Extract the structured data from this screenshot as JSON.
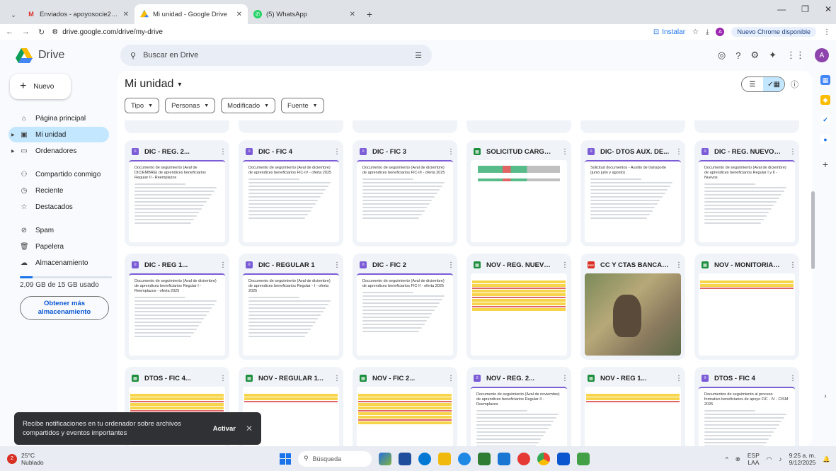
{
  "browser": {
    "tabs": [
      {
        "title": "Enviados - apoyosocie2025@",
        "icon": "gmail-icon",
        "active": false
      },
      {
        "title": "Mi unidad - Google Drive",
        "icon": "drive-icon",
        "active": true
      },
      {
        "title": "(5) WhatsApp",
        "icon": "whatsapp-icon",
        "active": false
      }
    ],
    "url": "drive.google.com/drive/my-drive",
    "install_label": "Instalar",
    "profile_initial": "A",
    "update_label": "Nuevo Chrome disponible"
  },
  "drive": {
    "logo_text": "Drive",
    "search_placeholder": "Buscar en Drive",
    "avatar_initial": "A"
  },
  "sidebar": {
    "new_label": "Nuevo",
    "items": [
      {
        "label": "Página principal",
        "icon": "home-icon"
      },
      {
        "label": "Mi unidad",
        "icon": "drive-folder-icon"
      },
      {
        "label": "Ordenadores",
        "icon": "computer-icon"
      },
      {
        "label": "Compartido conmigo",
        "icon": "shared-icon"
      },
      {
        "label": "Reciente",
        "icon": "clock-icon"
      },
      {
        "label": "Destacados",
        "icon": "star-icon"
      },
      {
        "label": "Spam",
        "icon": "spam-icon"
      },
      {
        "label": "Papelera",
        "icon": "trash-icon"
      },
      {
        "label": "Almacenamiento",
        "icon": "cloud-icon"
      }
    ],
    "storage_text": "2,09 GB de 15 GB usado",
    "storage_fraction": 0.14,
    "more_storage": "Obtener más almacenamiento"
  },
  "main": {
    "title": "Mi unidad",
    "filters": [
      "Tipo",
      "Personas",
      "Modificado",
      "Fuente"
    ]
  },
  "files": {
    "row1": [
      {
        "name": "DIC - REG. 2...",
        "type": "doc",
        "preview": "Documento de seguimiento (Aval de DICIEMBRE) de aprendices beneficiarios Regular II - Reemplazos"
      },
      {
        "name": "DIC - FIC 4",
        "type": "doc",
        "preview": "Documento de seguimiento (Aval de diciembre) de aprendices beneficiarios FIC-IV - oferta 2025"
      },
      {
        "name": "DIC - FIC 3",
        "type": "doc",
        "preview": "Documento de seguimiento (Aval de diciembre) de aprendices beneficiarios FIC-III - oferta 2025"
      },
      {
        "name": "SOLICITUD CARGUE...",
        "type": "sheet",
        "preview": ""
      },
      {
        "name": "DIC- DTOS AUX. DE...",
        "type": "doc",
        "preview": "Solicitud documentos - Auxilio de transporte (junio julio y agosto)"
      },
      {
        "name": "DIC - REG. NUEVOS 1 Y 2",
        "type": "doc",
        "preview": "Documento de seguimiento (Aval de diciembre) de aprendices beneficiarios Regular I y II - Nuevos"
      }
    ],
    "row2": [
      {
        "name": "DIC - REG 1...",
        "type": "doc",
        "preview": "Documento de seguimiento (Aval de diciembre) de aprendices beneficiarios Regular I - Reemplazos - oferta 2025"
      },
      {
        "name": "DIC - REGULAR 1",
        "type": "doc",
        "preview": "Documento de seguimiento (Aval de diciembre) de aprendices beneficiarios Regular - I - oferta 2025"
      },
      {
        "name": "DIC - FIC 2",
        "type": "doc",
        "preview": "Documento de seguimiento (Aval de diciembre) de aprendices beneficiarios FIC-II - oferta 2025"
      },
      {
        "name": "NOV - REG. NUEVOS 1 ...",
        "type": "sheet",
        "preview": ""
      },
      {
        "name": "CC Y CTAS BANCARIA...",
        "type": "pdf",
        "preview": ""
      },
      {
        "name": "NOV - MONITORIAS II - ...",
        "type": "sheet",
        "preview": ""
      }
    ],
    "row3": [
      {
        "name": "DTOS - FIC 4...",
        "type": "sheet",
        "preview": ""
      },
      {
        "name": "NOV - REGULAR 1...",
        "type": "sheet",
        "preview": ""
      },
      {
        "name": "NOV - FIC 2...",
        "type": "sheet",
        "preview": ""
      },
      {
        "name": "NOV - REG. 2...",
        "type": "doc",
        "preview": "Documento de seguimiento (Aval de noviembre) de aprendices beneficiarios Regular II - Reemplazos"
      },
      {
        "name": "NOV - REG 1...",
        "type": "sheet",
        "preview": ""
      },
      {
        "name": "DTOS - FIC 4",
        "type": "doc",
        "preview": "Documentos de seguimiento al proceso formativo beneficiarios de apoyo FIC - IV - CISM 2025"
      }
    ]
  },
  "toast": {
    "text": "Recibe notificaciones en tu ordenador sobre archivos compartidos y eventos importantes",
    "action": "Activar"
  },
  "taskbar": {
    "temp": "25°C",
    "weather": "Nublado",
    "weather_badge": "2",
    "search_label": "Búsqueda",
    "lang": "ESP",
    "lang2": "LAA",
    "time": "9:25 a. m.",
    "date": "9/12/2025"
  }
}
